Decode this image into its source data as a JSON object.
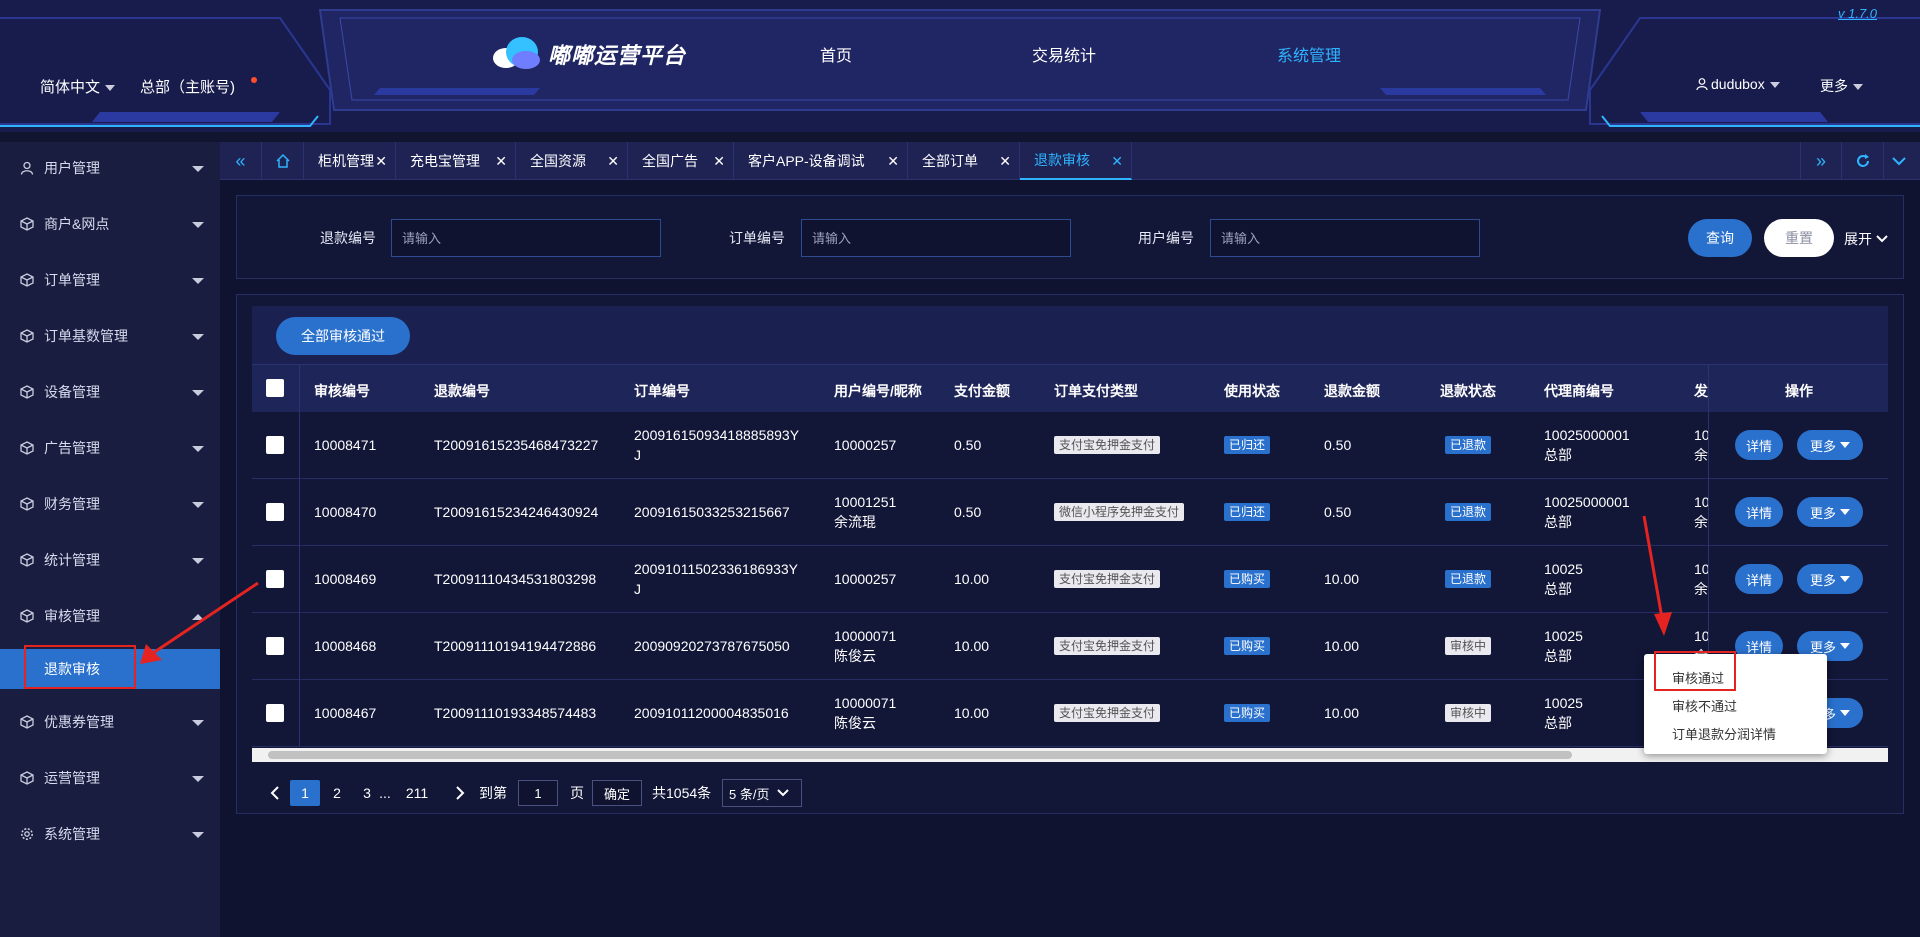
{
  "header": {
    "language": "简体中文",
    "org": "总部（主账号)",
    "brand": "嘟嘟运营平台",
    "nav": [
      "首页",
      "交易统计",
      "系统管理"
    ],
    "version": "v 1.7.0",
    "username": "dudubox",
    "more": "更多"
  },
  "sidebar": {
    "items": [
      {
        "label": "用户管理",
        "icon": "user-icon"
      },
      {
        "label": "商户&网点",
        "icon": "cube-icon"
      },
      {
        "label": "订单管理",
        "icon": "cube-icon"
      },
      {
        "label": "订单基数管理",
        "icon": "cube-icon"
      },
      {
        "label": "设备管理",
        "icon": "cube-icon"
      },
      {
        "label": "广告管理",
        "icon": "cube-icon"
      },
      {
        "label": "财务管理",
        "icon": "cube-icon"
      },
      {
        "label": "统计管理",
        "icon": "cube-icon"
      },
      {
        "label": "审核管理",
        "icon": "cube-icon"
      },
      {
        "label": "优惠券管理",
        "icon": "cube-icon"
      },
      {
        "label": "运营管理",
        "icon": "cube-icon"
      },
      {
        "label": "系统管理",
        "icon": "gear-icon"
      }
    ],
    "active_sub": "退款审核"
  },
  "tabs": [
    "柜机管理",
    "充电宝管理",
    "全国资源",
    "全国广告",
    "客户APP-设备调试",
    "全部订单",
    "退款审核"
  ],
  "search": {
    "fields": [
      {
        "label": "退款编号",
        "placeholder": "请输入"
      },
      {
        "label": "订单编号",
        "placeholder": "请输入"
      },
      {
        "label": "用户编号",
        "placeholder": "请输入"
      }
    ],
    "query": "查询",
    "reset": "重置",
    "expand": "展开"
  },
  "toolbar": {
    "approve_all": "全部审核通过"
  },
  "table": {
    "headers": [
      "审核编号",
      "退款编号",
      "订单编号",
      "用户编号/昵称",
      "支付金额",
      "订单支付类型",
      "使用状态",
      "退款金额",
      "退款状态",
      "代理商编号",
      "发",
      "操作"
    ],
    "rows": [
      {
        "audit_id": "10008471",
        "refund_no": "T20091615235468473227",
        "order_l1": "20091615093418885893Y",
        "order_l2": "J",
        "user_l1": "10000257",
        "user_l2": "",
        "pay": "0.50",
        "pay_type": "支付宝免押金支付",
        "use_state": "已归还",
        "refund_amt": "0.50",
        "refund_state": "已退款",
        "refund_state_style": "blue",
        "agent_l1": "10025000001",
        "agent_l2": "总部",
        "extra_l1": "10",
        "extra_l2": "余"
      },
      {
        "audit_id": "10008470",
        "refund_no": "T20091615234246430924",
        "order_l1": "20091615033253215667",
        "order_l2": "",
        "user_l1": "10001251",
        "user_l2": "余流琨",
        "pay": "0.50",
        "pay_type": "微信小程序免押金支付",
        "use_state": "已归还",
        "refund_amt": "0.50",
        "refund_state": "已退款",
        "refund_state_style": "blue",
        "agent_l1": "10025000001",
        "agent_l2": "总部",
        "extra_l1": "10",
        "extra_l2": "余"
      },
      {
        "audit_id": "10008469",
        "refund_no": "T20091110434531803298",
        "order_l1": "20091011502336186933Y",
        "order_l2": "J",
        "user_l1": "10000257",
        "user_l2": "",
        "pay": "10.00",
        "pay_type": "支付宝免押金支付",
        "use_state": "已购买",
        "refund_amt": "10.00",
        "refund_state": "已退款",
        "refund_state_style": "blue",
        "agent_l1": "10025",
        "agent_l2": "总部",
        "extra_l1": "10",
        "extra_l2": "余"
      },
      {
        "audit_id": "10008468",
        "refund_no": "T20091110194194472886",
        "order_l1": "20090920273787675050",
        "order_l2": "",
        "user_l1": "10000071",
        "user_l2": "陈俊云",
        "pay": "10.00",
        "pay_type": "支付宝免押金支付",
        "use_state": "已购买",
        "refund_amt": "10.00",
        "refund_state": "审核中",
        "refund_state_style": "gray",
        "agent_l1": "10025",
        "agent_l2": "总部",
        "extra_l1": "10",
        "extra_l2": "余"
      },
      {
        "audit_id": "10008467",
        "refund_no": "T20091110193348574483",
        "order_l1": "20091011200004835016",
        "order_l2": "",
        "user_l1": "10000071",
        "user_l2": "陈俊云",
        "pay": "10.00",
        "pay_type": "支付宝免押金支付",
        "use_state": "已购买",
        "refund_amt": "10.00",
        "refund_state": "审核中",
        "refund_state_style": "gray",
        "agent_l1": "10025",
        "agent_l2": "总部",
        "extra_l1": "",
        "extra_l2": ""
      }
    ],
    "detail": "详情",
    "more": "更多"
  },
  "dropdown": [
    "审核通过",
    "审核不通过",
    "订单退款分润详情"
  ],
  "pagination": {
    "pages": [
      "1",
      "2",
      "3",
      "...",
      "211"
    ],
    "goto": "到第",
    "page_input": "1",
    "page_unit": "页",
    "confirm": "确定",
    "total": "共1054条",
    "page_size": "5 条/页"
  },
  "colors": {
    "accent": "#2fb4ff",
    "primary": "#2a71cd",
    "bg": "#111530",
    "annotation": "#e52421"
  }
}
